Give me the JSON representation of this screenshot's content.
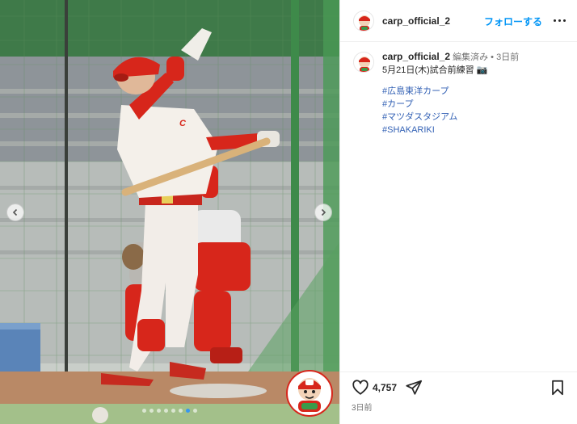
{
  "post": {
    "username": "carp_official_2",
    "follow_label": "フォローする",
    "edited_label": "編集済み",
    "separator": "•",
    "relative_time": "3日前",
    "caption": "5月21日(木)試合前練習",
    "caption_emoji": "📷",
    "hashtags": [
      "#広島東洋カープ",
      "#カープ",
      "#マツダスタジアム",
      "#SHAKARIKI"
    ],
    "like_count": "4,757",
    "date_label": "3日前"
  },
  "media": {
    "slide_count": 8,
    "active_slide": 6
  },
  "colors": {
    "follow_blue": "#0095f6",
    "hashtag_blue": "#3462b5",
    "carp_red": "#d7261b"
  },
  "icons": {
    "prev": "chevron-left-icon",
    "next": "chevron-right-icon",
    "more": "more-horizontal-icon",
    "like": "heart-icon",
    "share": "paper-plane-icon",
    "save": "bookmark-icon"
  }
}
